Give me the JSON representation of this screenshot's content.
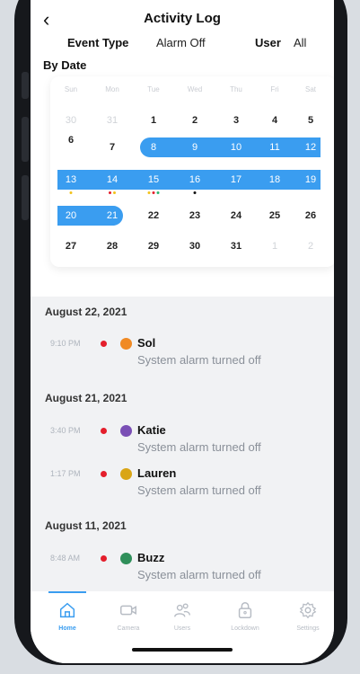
{
  "header": {
    "title": "Activity Log",
    "event_type_label": "Event Type",
    "event_type_value": "Alarm Off",
    "user_label": "User",
    "user_value": "All",
    "by_date_label": "By Date"
  },
  "calendar": {
    "weekdays": [
      "Sun",
      "Mon",
      "Tue",
      "Wed",
      "Thu",
      "Fri",
      "Sat"
    ],
    "weeks": [
      [
        "30",
        "31",
        "1",
        "2",
        "3",
        "4",
        "5"
      ],
      [
        "6",
        "7",
        "8",
        "9",
        "10",
        "11",
        "12"
      ],
      [
        "13",
        "14",
        "15",
        "16",
        "17",
        "18",
        "19"
      ],
      [
        "20",
        "21",
        "22",
        "23",
        "24",
        "25",
        "26"
      ],
      [
        "27",
        "28",
        "29",
        "30",
        "31",
        "1",
        "2"
      ]
    ],
    "selected_range": [
      "8",
      "21"
    ],
    "colors": {
      "selection": "#3a9df0",
      "red": "#e41e2b",
      "yellow": "#f2c21a",
      "green": "#2bb673",
      "black": "#111111"
    }
  },
  "activity": [
    {
      "date": "August 22, 2021",
      "entries": [
        {
          "time": "9:10 PM",
          "name": "Sol",
          "desc": "System alarm turned off",
          "avatar_color": "#f08a24"
        }
      ]
    },
    {
      "date": "August 21, 2021",
      "entries": [
        {
          "time": "3:40 PM",
          "name": "Katie",
          "desc": "System alarm turned off",
          "avatar_color": "#7a4fb5"
        },
        {
          "time": "1:17 PM",
          "name": "Lauren",
          "desc": "System alarm turned off",
          "avatar_color": "#d9a516"
        }
      ]
    },
    {
      "date": "August 11, 2021",
      "entries": [
        {
          "time": "8:48 AM",
          "name": "Buzz",
          "desc": "System alarm turned off",
          "avatar_color": "#2f8f5a"
        }
      ]
    }
  ],
  "tabs": [
    {
      "label": "Home",
      "icon": "home-icon",
      "active": true
    },
    {
      "label": "Camera",
      "icon": "camera-icon",
      "active": false
    },
    {
      "label": "Users",
      "icon": "users-icon",
      "active": false
    },
    {
      "label": "Lockdown",
      "icon": "lock-icon",
      "active": false
    },
    {
      "label": "Settings",
      "icon": "gear-icon",
      "active": false
    }
  ]
}
